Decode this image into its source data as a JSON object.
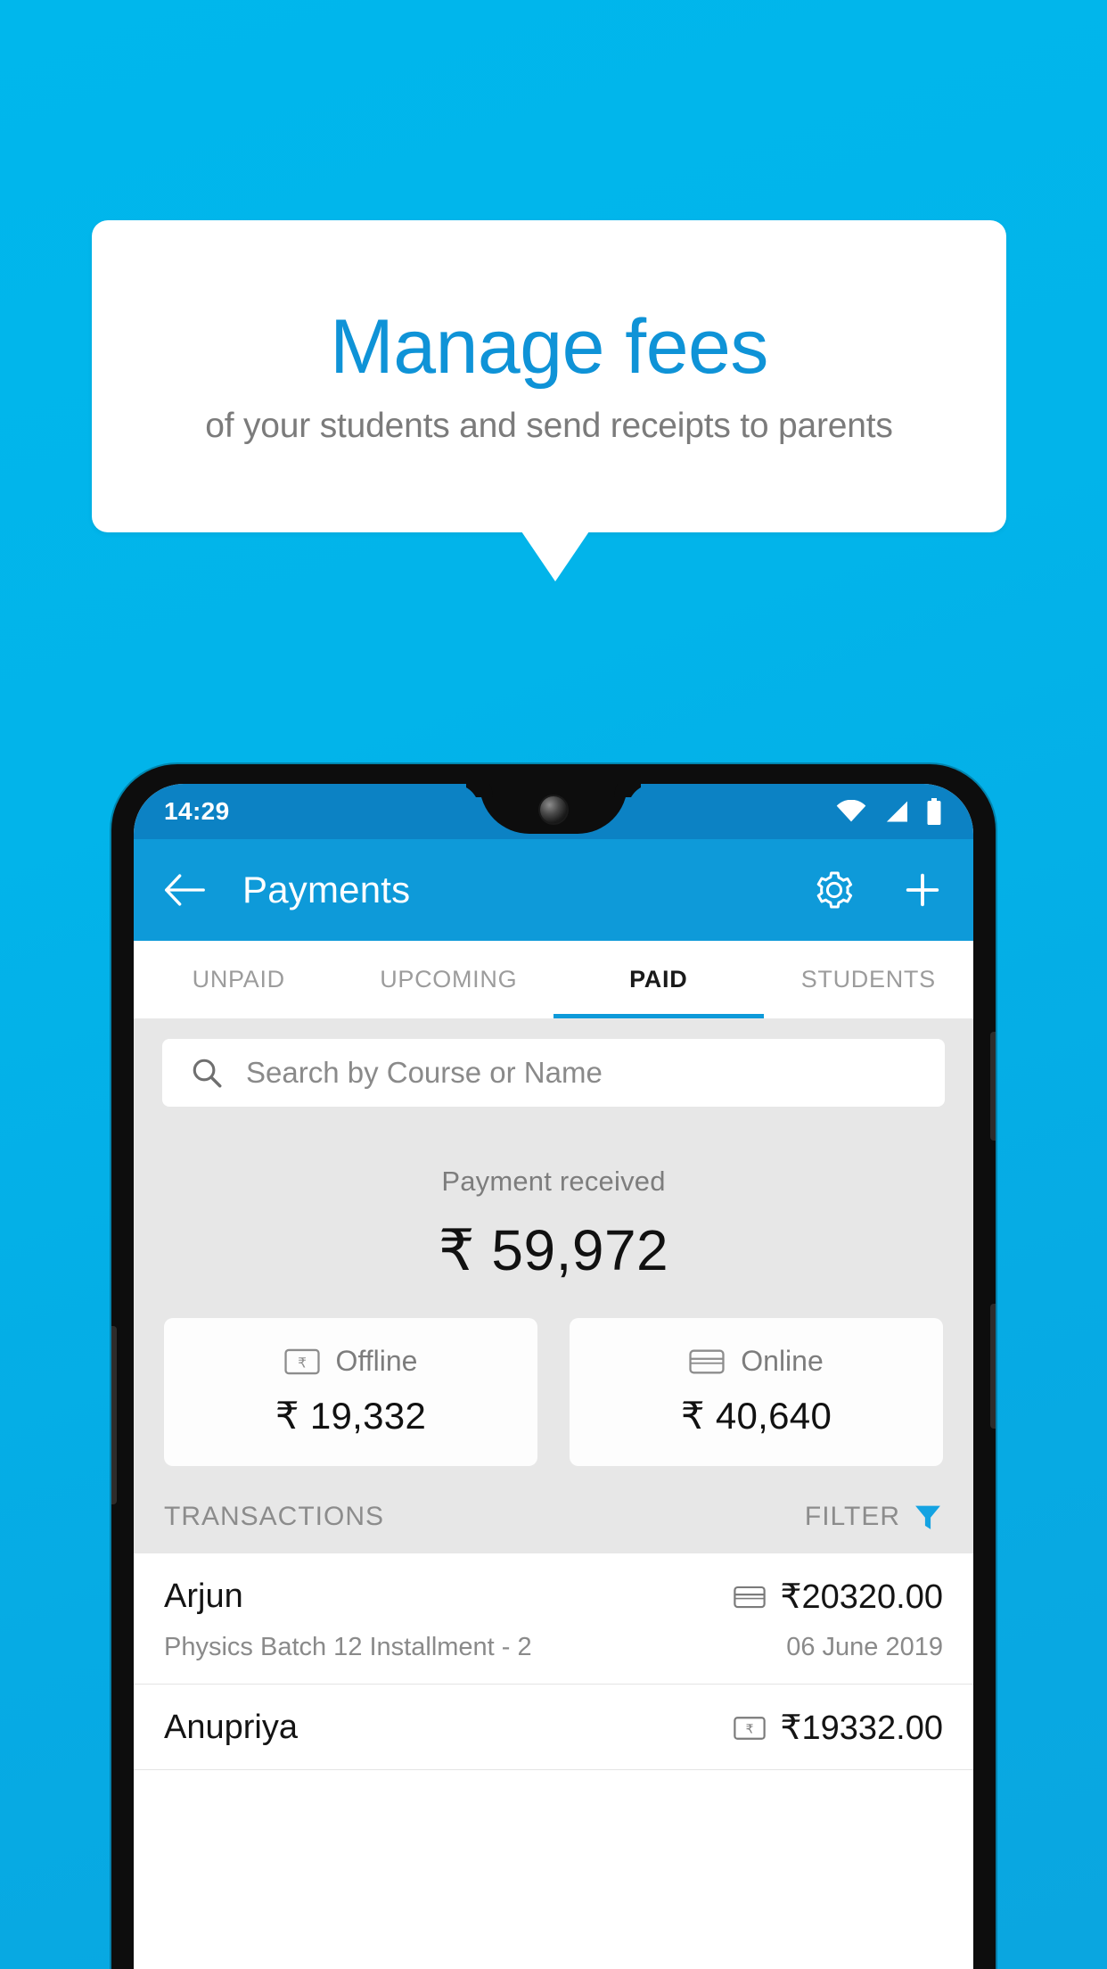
{
  "promo": {
    "title": "Manage fees",
    "subtitle": "of your students and send receipts to parents"
  },
  "colors": {
    "background": "#00b5ea",
    "accent": "#0e9ad9",
    "title_blue": "#0f93d7",
    "statusbar": "#0c82c4",
    "content_bg": "#e7e7e7"
  },
  "phone": {
    "statusbar": {
      "time": "14:29",
      "icons": [
        "wifi-icon",
        "signal-icon",
        "battery-icon"
      ]
    },
    "appbar": {
      "back_icon": "arrow-left-icon",
      "title": "Payments",
      "settings_icon": "gear-icon",
      "add_icon": "plus-icon"
    },
    "tabs": [
      {
        "label": "UNPAID",
        "active": false
      },
      {
        "label": "UPCOMING",
        "active": false
      },
      {
        "label": "PAID",
        "active": true
      },
      {
        "label": "STUDENTS",
        "active": false
      }
    ],
    "search": {
      "icon": "search-icon",
      "placeholder": "Search by Course or Name",
      "value": ""
    },
    "summary": {
      "label": "Payment received",
      "amount": "₹ 59,972"
    },
    "method_cards": [
      {
        "icon": "cash-note-icon",
        "label": "Offline",
        "amount": "₹ 19,332"
      },
      {
        "icon": "credit-card-icon",
        "label": "Online",
        "amount": "₹ 40,640"
      }
    ],
    "section": {
      "title": "TRANSACTIONS",
      "filter_label": "FILTER",
      "filter_icon": "funnel-icon"
    },
    "transactions": [
      {
        "name": "Arjun",
        "amount": "₹20320.00",
        "method_icon": "credit-card-icon",
        "description": "Physics Batch 12 Installment - 2",
        "date": "06 June 2019"
      },
      {
        "name": "Anupriya",
        "amount": "₹19332.00",
        "method_icon": "cash-note-icon",
        "description": "",
        "date": ""
      }
    ]
  }
}
